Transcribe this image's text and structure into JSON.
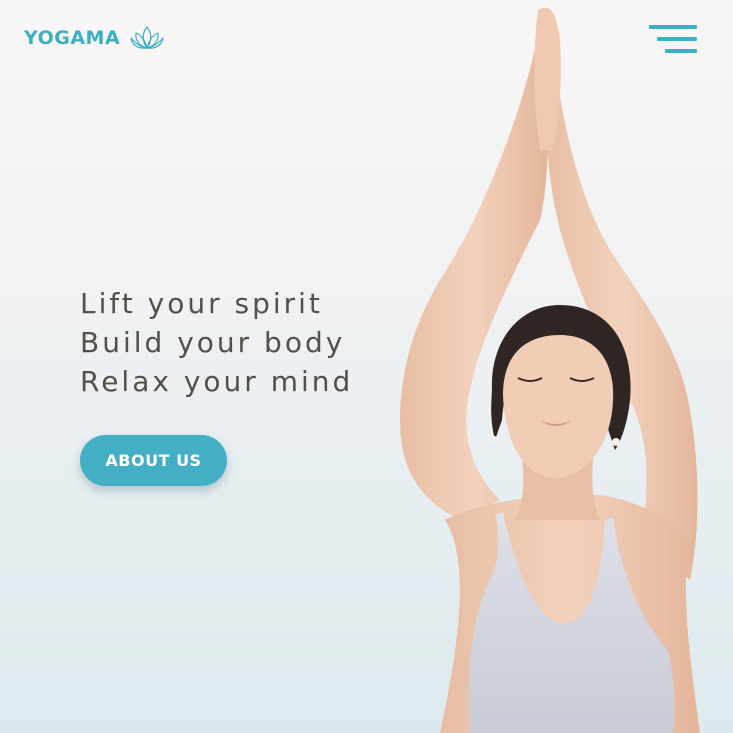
{
  "header": {
    "logo_text": "YOGAMA",
    "logo_icon": "lotus-icon",
    "menu_icon": "hamburger-menu-icon"
  },
  "hero": {
    "lines": [
      "Lift your spirit",
      "Build your body",
      "Relax your mind"
    ],
    "cta_label": "ABOUT US",
    "image": "woman-yoga-pose-arms-raised"
  },
  "colors": {
    "accent": "#3ab0c3",
    "button": "#44afc4",
    "text": "#555049"
  }
}
